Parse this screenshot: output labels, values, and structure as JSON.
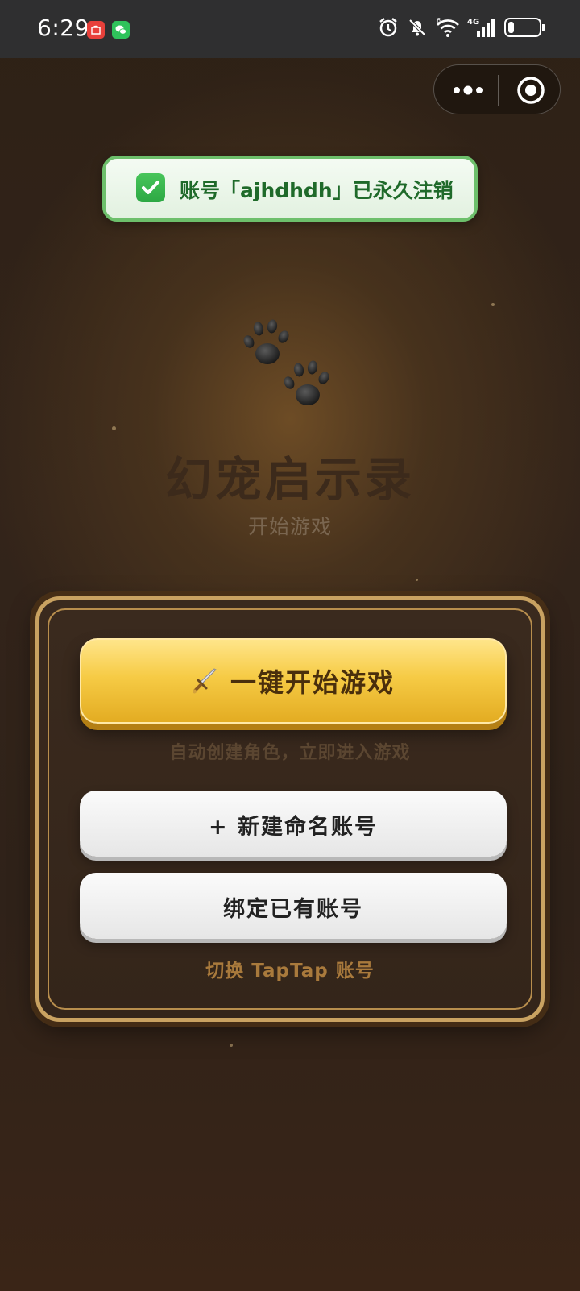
{
  "status_bar": {
    "time": "6:29",
    "network": "4G",
    "wifi_label": "6",
    "battery_percent": 20
  },
  "toast": {
    "message": "账号「ajhdhdh」已永久注销"
  },
  "header": {
    "title": "幻宠启示录",
    "subtitle": "开始游戏"
  },
  "panel": {
    "start_button": "一键开始游戏",
    "start_hint": "自动创建角色，立即进入游戏",
    "new_account_button": "+  新建命名账号",
    "bind_account_button": "绑定已有账号",
    "switch_link": "切换 TapTap 账号"
  },
  "colors": {
    "accent_gold": "#f6cb45",
    "toast_green": "#6dbf6b",
    "panel_border": "#c9a261"
  }
}
